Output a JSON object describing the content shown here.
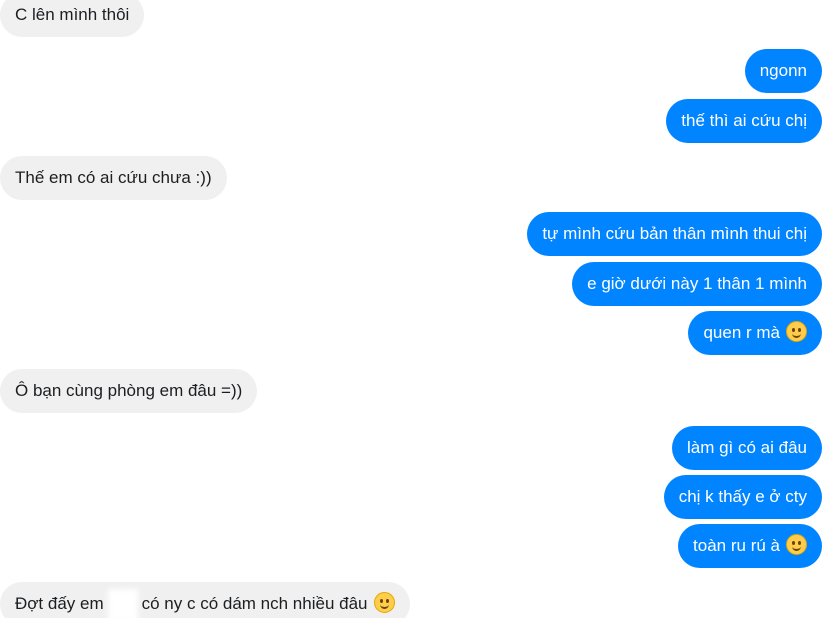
{
  "messages": [
    {
      "side": "in",
      "text": "C lên mình thôi"
    },
    {
      "side": "out",
      "text": "ngonn"
    },
    {
      "side": "out",
      "text": "thế thì ai cứu chị"
    },
    {
      "side": "in",
      "text": "Thế em có ai cứu chưa :))"
    },
    {
      "side": "out",
      "text": "tự mình cứu bản thân mình thui chị"
    },
    {
      "side": "out",
      "text": "e giờ dưới này 1 thân 1 mình"
    },
    {
      "side": "out",
      "text": "quen r mà",
      "emoji": "slightly-smiling-face"
    },
    {
      "side": "in",
      "text": "Ô bạn cùng phòng em đâu =))"
    },
    {
      "side": "out",
      "text": "làm gì có ai đâu"
    },
    {
      "side": "out",
      "text": "chị k thấy e ở cty"
    },
    {
      "side": "out",
      "text": "toàn ru rú à",
      "emoji": "slightly-smiling-face"
    },
    {
      "side": "in",
      "text_before": "Đợt đấy em",
      "text_after": "có ny c có dám nch nhiều đâu",
      "emoji": "slightly-smiling-face",
      "redacted": true
    }
  ],
  "colors": {
    "outgoing_bubble": "#0084ff",
    "incoming_bubble": "#f0f0f0",
    "outgoing_text": "#ffffff",
    "incoming_text": "#1c1e21"
  }
}
